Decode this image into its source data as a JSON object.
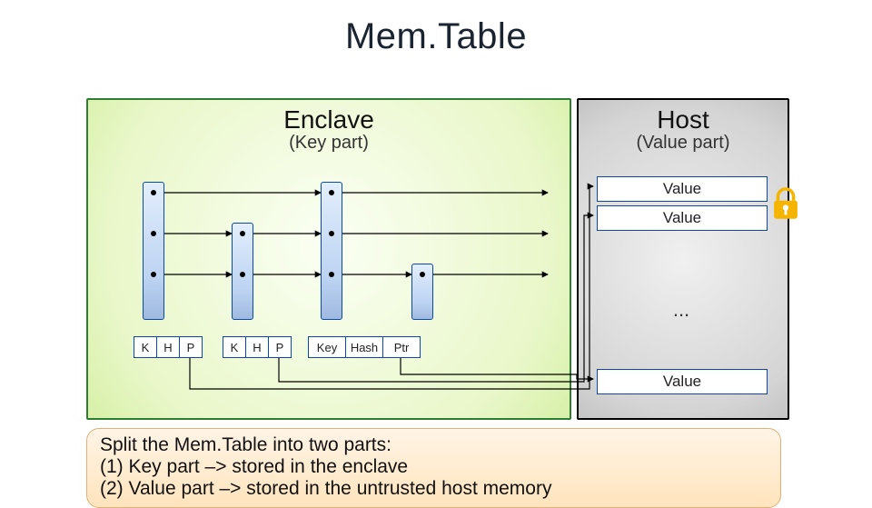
{
  "title": "Mem.Table",
  "enclave": {
    "heading": "Enclave",
    "sub": "(Key part)"
  },
  "host": {
    "heading": "Host",
    "sub": "(Value part)"
  },
  "khp1": {
    "k": "K",
    "h": "H",
    "p": "P"
  },
  "khp2": {
    "k": "K",
    "h": "H",
    "p": "P"
  },
  "khp3": {
    "k": "Key",
    "h": "Hash",
    "p": "Ptr"
  },
  "values": {
    "v1": "Value",
    "v2": "Value",
    "v3": "Value",
    "dots": "..."
  },
  "caption": {
    "l1": "Split the Mem.Table into two parts:",
    "l2": "(1) Key part –> stored in the enclave",
    "l3": "(2) Value part –> stored in the untrusted host memory"
  }
}
